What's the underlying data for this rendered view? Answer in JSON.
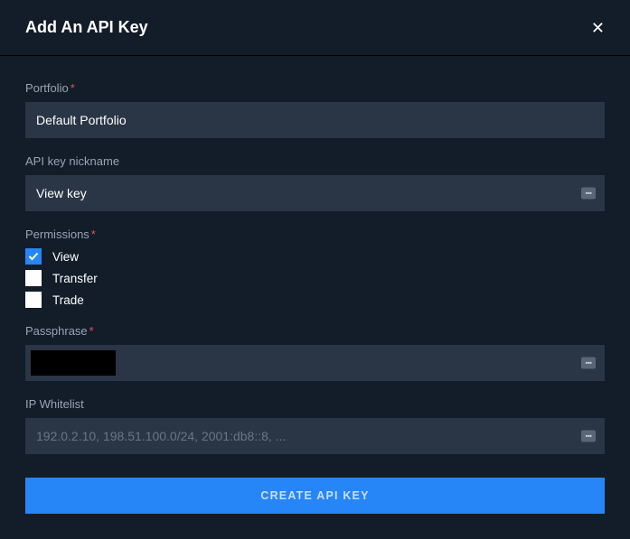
{
  "header": {
    "title": "Add An API Key"
  },
  "form": {
    "portfolio": {
      "label": "Portfolio",
      "value": "Default Portfolio"
    },
    "nickname": {
      "label": "API key nickname",
      "value": "View key"
    },
    "permissions": {
      "label": "Permissions",
      "options": [
        {
          "label": "View",
          "checked": true
        },
        {
          "label": "Transfer",
          "checked": false
        },
        {
          "label": "Trade",
          "checked": false
        }
      ]
    },
    "passphrase": {
      "label": "Passphrase"
    },
    "ipwhitelist": {
      "label": "IP Whitelist",
      "placeholder": "192.0.2.10, 198.51.100.0/24, 2001:db8::8, ..."
    },
    "submit_label": "CREATE API KEY",
    "required_marker": "*"
  }
}
